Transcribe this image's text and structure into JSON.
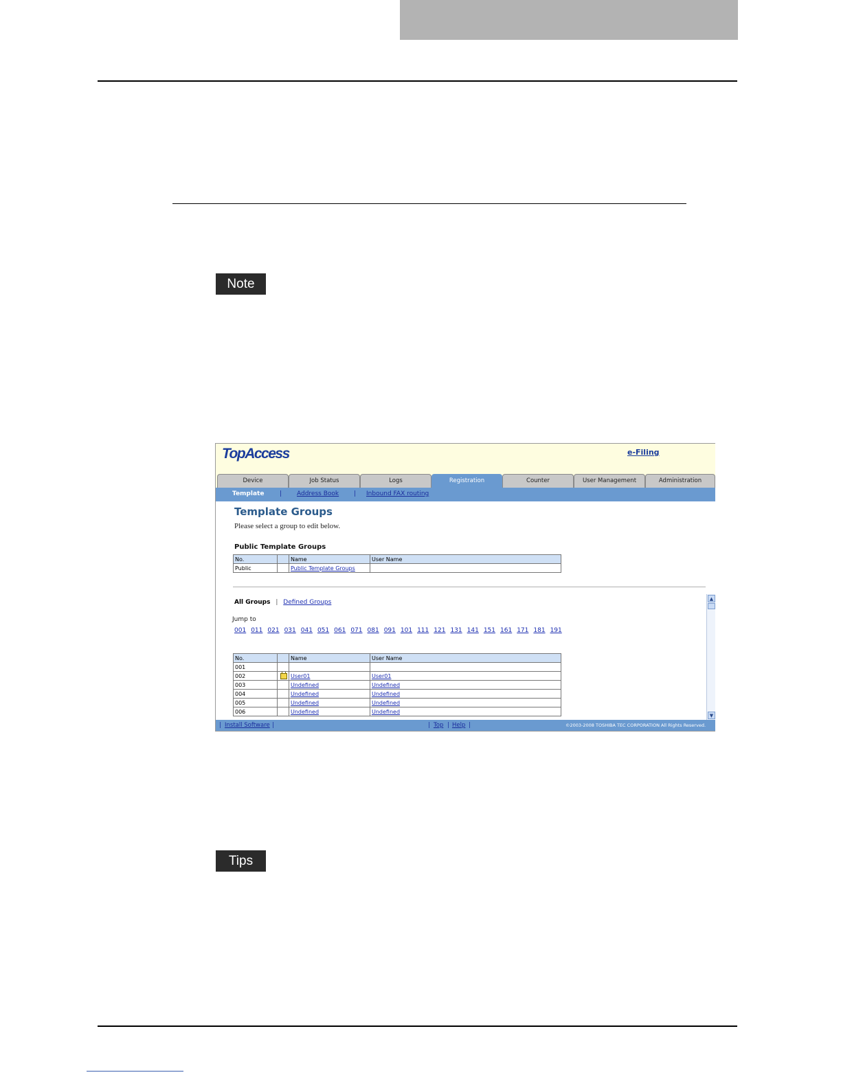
{
  "labels": {
    "note": "Note",
    "tips": "Tips"
  },
  "app": {
    "logo": "TopAccess",
    "header_link": "e-Filing",
    "tabs": [
      "Device",
      "Job Status",
      "Logs",
      "Registration",
      "Counter",
      "User Management",
      "Administration"
    ],
    "active_tab": "Registration",
    "subnav": {
      "current": "Template",
      "links": [
        "Address Book",
        "Inbound FAX routing"
      ],
      "separator": "|"
    },
    "page_title": "Template Groups",
    "instruction": "Please select a group to edit below.",
    "public_section": {
      "title": "Public Template Groups",
      "columns": [
        "No.",
        "",
        "Name",
        "User Name"
      ],
      "rows": [
        {
          "no": "Public",
          "name": "Public Template Groups",
          "user": ""
        }
      ]
    },
    "group_filter": {
      "current": "All Groups",
      "separator": "|",
      "link": "Defined Groups"
    },
    "jump_label": "Jump to",
    "jump_links": [
      "001",
      "011",
      "021",
      "031",
      "041",
      "051",
      "061",
      "071",
      "081",
      "091",
      "101",
      "111",
      "121",
      "131",
      "141",
      "151",
      "161",
      "171",
      "181",
      "191"
    ],
    "groups_table": {
      "columns": [
        "No.",
        "",
        "Name",
        "User Name"
      ],
      "rows": [
        {
          "no": "001",
          "locked": false,
          "name": "",
          "user": ""
        },
        {
          "no": "002",
          "locked": true,
          "name": "User01",
          "user": "User01"
        },
        {
          "no": "003",
          "locked": false,
          "name": "Undefined",
          "user": "Undefined"
        },
        {
          "no": "004",
          "locked": false,
          "name": "Undefined",
          "user": "Undefined"
        },
        {
          "no": "005",
          "locked": false,
          "name": "Undefined",
          "user": "Undefined"
        },
        {
          "no": "006",
          "locked": false,
          "name": "Undefined",
          "user": "Undefined"
        }
      ]
    },
    "footer": {
      "left_sep": "|",
      "install": "Install Software",
      "sep": "|",
      "top": "Top",
      "help": "Help",
      "copyright": "©2003-2008 TOSHIBA TEC CORPORATION All Rights Reserved."
    }
  }
}
